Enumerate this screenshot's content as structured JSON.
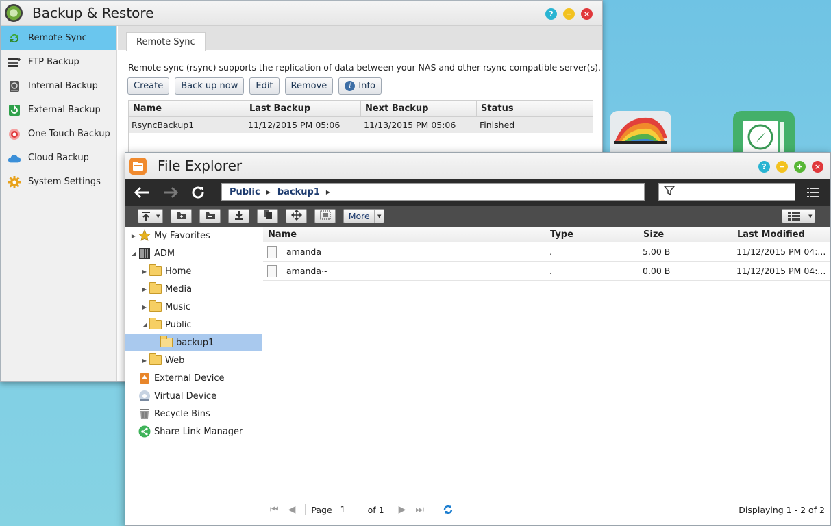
{
  "backup_window": {
    "title": "Backup & Restore",
    "sidebar": [
      {
        "label": "Remote Sync",
        "icon": "sync-icon",
        "active": true
      },
      {
        "label": "FTP Backup",
        "icon": "ftp-icon"
      },
      {
        "label": "Internal Backup",
        "icon": "internal-drive-icon"
      },
      {
        "label": "External Backup",
        "icon": "external-drive-icon"
      },
      {
        "label": "One Touch Backup",
        "icon": "one-touch-icon"
      },
      {
        "label": "Cloud Backup",
        "icon": "cloud-icon"
      },
      {
        "label": "System Settings",
        "icon": "gear-icon"
      }
    ],
    "tab": "Remote Sync",
    "description": "Remote sync (rsync) supports the replication of data between your NAS and other rsync-compatible server(s).",
    "buttons": {
      "create": "Create",
      "backup_now": "Back up now",
      "edit": "Edit",
      "remove": "Remove",
      "info": "Info"
    },
    "table": {
      "headers": [
        "Name",
        "Last Backup",
        "Next Backup",
        "Status"
      ],
      "rows": [
        [
          "RsyncBackup1",
          "11/12/2015 PM 05:06",
          "11/13/2015 PM 05:06",
          "Finished"
        ]
      ]
    }
  },
  "file_explorer": {
    "title": "File Explorer",
    "breadcrumb": [
      "Public",
      "backup1"
    ],
    "toolbar": {
      "more": "More"
    },
    "tree": [
      {
        "label": "My Favorites",
        "icon": "star-icon"
      },
      {
        "label": "ADM",
        "icon": "server-icon"
      },
      {
        "label": "Home",
        "icon": "folder-icon"
      },
      {
        "label": "Media",
        "icon": "folder-icon"
      },
      {
        "label": "Music",
        "icon": "folder-icon"
      },
      {
        "label": "Public",
        "icon": "folder-icon"
      },
      {
        "label": "backup1",
        "icon": "folder-icon",
        "selected": true
      },
      {
        "label": "Web",
        "icon": "folder-icon"
      },
      {
        "label": "External Device",
        "icon": "external-device-icon"
      },
      {
        "label": "Virtual Device",
        "icon": "virtual-device-icon"
      },
      {
        "label": "Recycle Bins",
        "icon": "trash-icon"
      },
      {
        "label": "Share Link Manager",
        "icon": "share-icon"
      }
    ],
    "list": {
      "headers": [
        "Name",
        "Type",
        "Size",
        "Last Modified"
      ],
      "rows": [
        {
          "name": "amanda",
          "type": ".",
          "size": "5.00 B",
          "modified": "11/12/2015 PM 04:..."
        },
        {
          "name": "amanda~",
          "type": ".",
          "size": "0.00 B",
          "modified": "11/12/2015 PM 04:..."
        }
      ]
    },
    "pager": {
      "page_label": "Page",
      "page": "1",
      "of_label": "of 1",
      "displaying": "Displaying 1 - 2 of 2"
    }
  }
}
